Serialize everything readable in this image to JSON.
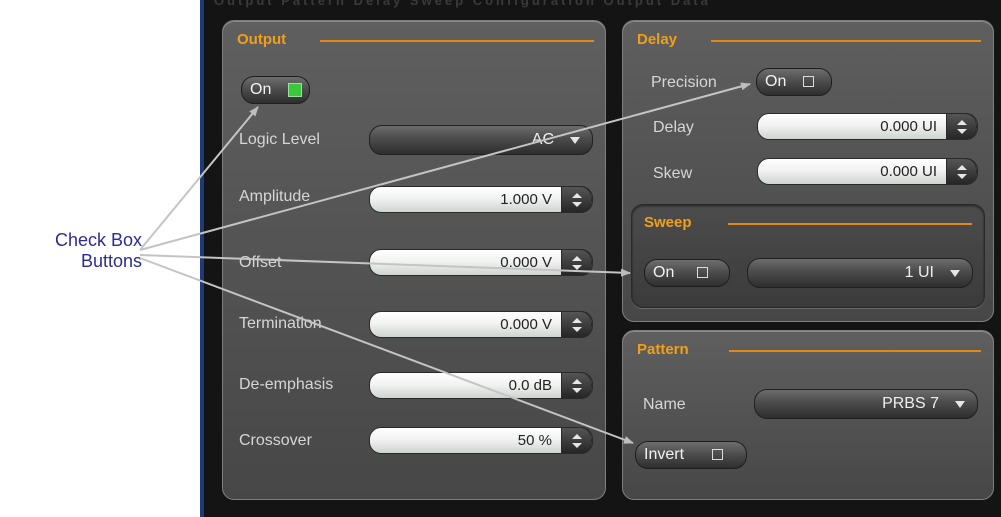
{
  "annotation": {
    "line1": "Check Box",
    "line2": "Buttons"
  },
  "top_strip": "Output  Pattern  Delay  Sweep  Configuration  Output  Data",
  "output": {
    "title": "Output",
    "on_button": "On",
    "on_checked": true,
    "logic_level": {
      "label": "Logic Level",
      "value": "AC"
    },
    "amplitude": {
      "label": "Amplitude",
      "value": "1.000 V"
    },
    "offset": {
      "label": "Offset",
      "value": "0.000 V"
    },
    "termination": {
      "label": "Termination",
      "value": "0.000 V"
    },
    "deemphasis": {
      "label": "De-emphasis",
      "value": "0.0 dB"
    },
    "crossover": {
      "label": "Crossover",
      "value": "50 %"
    }
  },
  "delay": {
    "title": "Delay",
    "precision": {
      "label": "Precision",
      "button": "On"
    },
    "delay": {
      "label": "Delay",
      "value": "0.000 UI"
    },
    "skew": {
      "label": "Skew",
      "value": "0.000 UI"
    }
  },
  "sweep": {
    "title": "Sweep",
    "on_button": "On",
    "range_value": "1 UI"
  },
  "pattern": {
    "title": "Pattern",
    "name": {
      "label": "Name",
      "value": "PRBS 7"
    },
    "invert_button": "Invert"
  },
  "colors": {
    "accent": "#f0a018",
    "annotation": "#2c2c8f",
    "checked": "#3cc83c"
  }
}
